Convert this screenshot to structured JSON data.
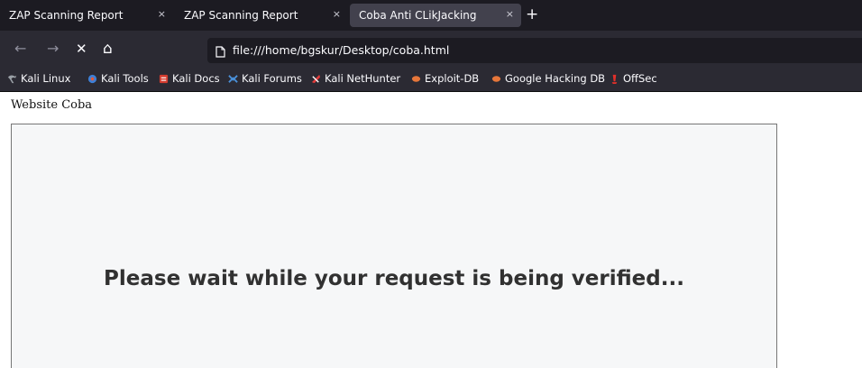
{
  "tabs": [
    {
      "label": "ZAP Scanning Report",
      "close": "×",
      "active": false
    },
    {
      "label": "ZAP Scanning Report",
      "close": "×",
      "active": false
    },
    {
      "label": "Coba Anti CLikJacking",
      "close": "×",
      "active": true
    }
  ],
  "new_tab": "+",
  "nav": {
    "back": "←",
    "forward": "→",
    "stop": "✕",
    "home": "⌂"
  },
  "address": {
    "url": "file:///home/bgskur/Desktop/coba.html"
  },
  "bookmarks": [
    {
      "label": "Kali Linux",
      "color": "#9aa0a6"
    },
    {
      "label": "Kali Tools",
      "color": "#3d7fd6"
    },
    {
      "label": "Kali Docs",
      "color": "#d33c2f"
    },
    {
      "label": "Kali Forums",
      "color": "#4a90d9"
    },
    {
      "label": "Kali NetHunter",
      "color": "#e23b3b"
    },
    {
      "label": "Exploit-DB",
      "color": "#e6763a"
    },
    {
      "label": "Google Hacking DB",
      "color": "#e6763a"
    },
    {
      "label": "OffSec",
      "color": "#e0302a"
    }
  ],
  "page": {
    "heading": "Website Coba",
    "frame_message": "Please wait while your request is being verified..."
  },
  "colors": {
    "toolbar": "#2b2a33",
    "tabstrip": "#1c1b22",
    "active_tab": "#42414d"
  }
}
